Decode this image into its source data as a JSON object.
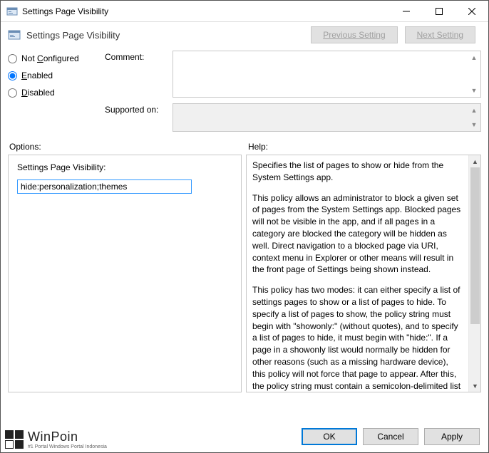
{
  "window": {
    "title": "Settings Page Visibility",
    "header_title": "Settings Page Visibility"
  },
  "nav": {
    "previous": "Previous Setting",
    "next": "Next Setting"
  },
  "radios": {
    "not_configured_pre": "Not ",
    "not_configured_accel": "C",
    "not_configured_post": "onfigured",
    "enabled_accel": "E",
    "enabled_post": "nabled",
    "disabled_accel": "D",
    "disabled_post": "isabled"
  },
  "fields": {
    "comment_label": "Comment:",
    "comment_value": "",
    "supported_label": "Supported on:",
    "supported_value": ""
  },
  "sections": {
    "options": "Options:",
    "help": "Help:"
  },
  "options": {
    "field_label": "Settings Page Visibility:",
    "field_value": "hide:personalization;themes"
  },
  "help": {
    "p1": "Specifies the list of pages to show or hide from the System Settings app.",
    "p2": "This policy allows an administrator to block a given set of pages from the System Settings app. Blocked pages will not be visible in the app, and if all pages in a category are blocked the category will be hidden as well. Direct navigation to a blocked page via URI, context menu in Explorer or other means will result in the front page of Settings being shown instead.",
    "p3": "This policy has two modes: it can either specify a list of settings pages to show or a list of pages to hide. To specify a list of pages to show, the policy string must begin with \"showonly:\" (without quotes), and to specify a list of pages to hide, it must begin with \"hide:\". If a page in a showonly list would normally be hidden for other reasons (such as a missing hardware device), this policy will not force that page to appear. After this, the policy string must contain a semicolon-delimited list of settings page identifiers. The identifier for any given settings page is the published URI for that page, minus the \"ms-settings:\" protocol part."
  },
  "buttons": {
    "ok": "OK",
    "cancel": "Cancel",
    "apply": "Apply"
  },
  "watermark": {
    "main": "WinPoin",
    "sub": "#1 Portal Windows Portal Indonesia"
  }
}
